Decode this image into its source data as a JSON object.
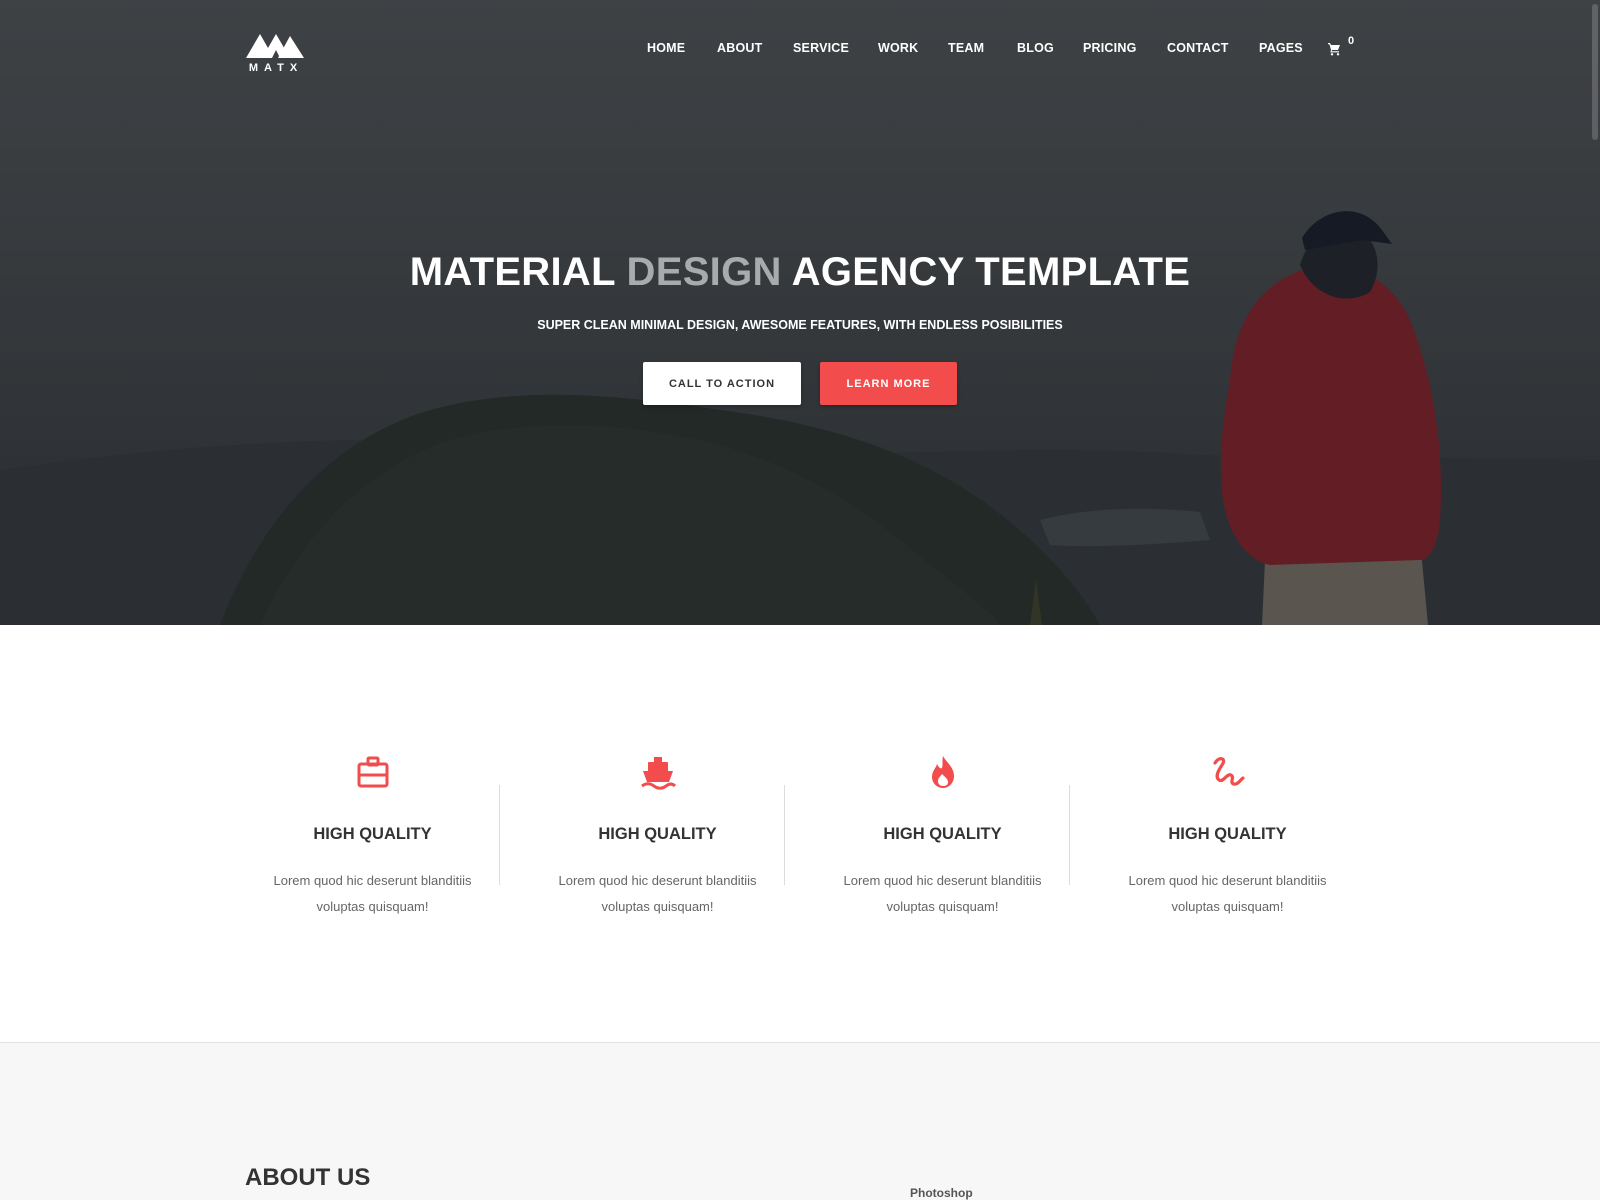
{
  "brand": {
    "name": "MATX"
  },
  "nav": {
    "items": [
      {
        "label": "HOME"
      },
      {
        "label": "ABOUT"
      },
      {
        "label": "SERVICE"
      },
      {
        "label": "WORK"
      },
      {
        "label": "TEAM"
      },
      {
        "label": "BLOG"
      },
      {
        "label": "PRICING"
      },
      {
        "label": "CONTACT"
      },
      {
        "label": "PAGES"
      }
    ],
    "cart_icon": "cart-icon",
    "cart_count": "0"
  },
  "hero": {
    "title_part1": "MATERIAL",
    "title_accent": "DESIGN",
    "title_part2": "AGENCY TEMPLATE",
    "subtitle": "SUPER CLEAN MINIMAL DESIGN, AWESOME FEATURES, WITH ENDLESS POSIBILITIES",
    "primary_button": "CALL TO ACTION",
    "secondary_button": "LEARN MORE"
  },
  "features": [
    {
      "icon": "briefcase-icon",
      "title": "HIGH QUALITY",
      "text": "Lorem quod hic deserunt blanditiis voluptas quisquam!"
    },
    {
      "icon": "ship-icon",
      "title": "HIGH QUALITY",
      "text": "Lorem quod hic deserunt blanditiis voluptas quisquam!"
    },
    {
      "icon": "flame-icon",
      "title": "HIGH QUALITY",
      "text": "Lorem quod hic deserunt blanditiis voluptas quisquam!"
    },
    {
      "icon": "gesture-icon",
      "title": "HIGH QUALITY",
      "text": "Lorem quod hic deserunt blanditiis voluptas quisquam!"
    }
  ],
  "about": {
    "title": "ABOUT US",
    "skill_label": "Photoshop"
  },
  "colors": {
    "accent": "#f34c4c",
    "text_dark": "#333333",
    "text_muted": "#666666"
  }
}
